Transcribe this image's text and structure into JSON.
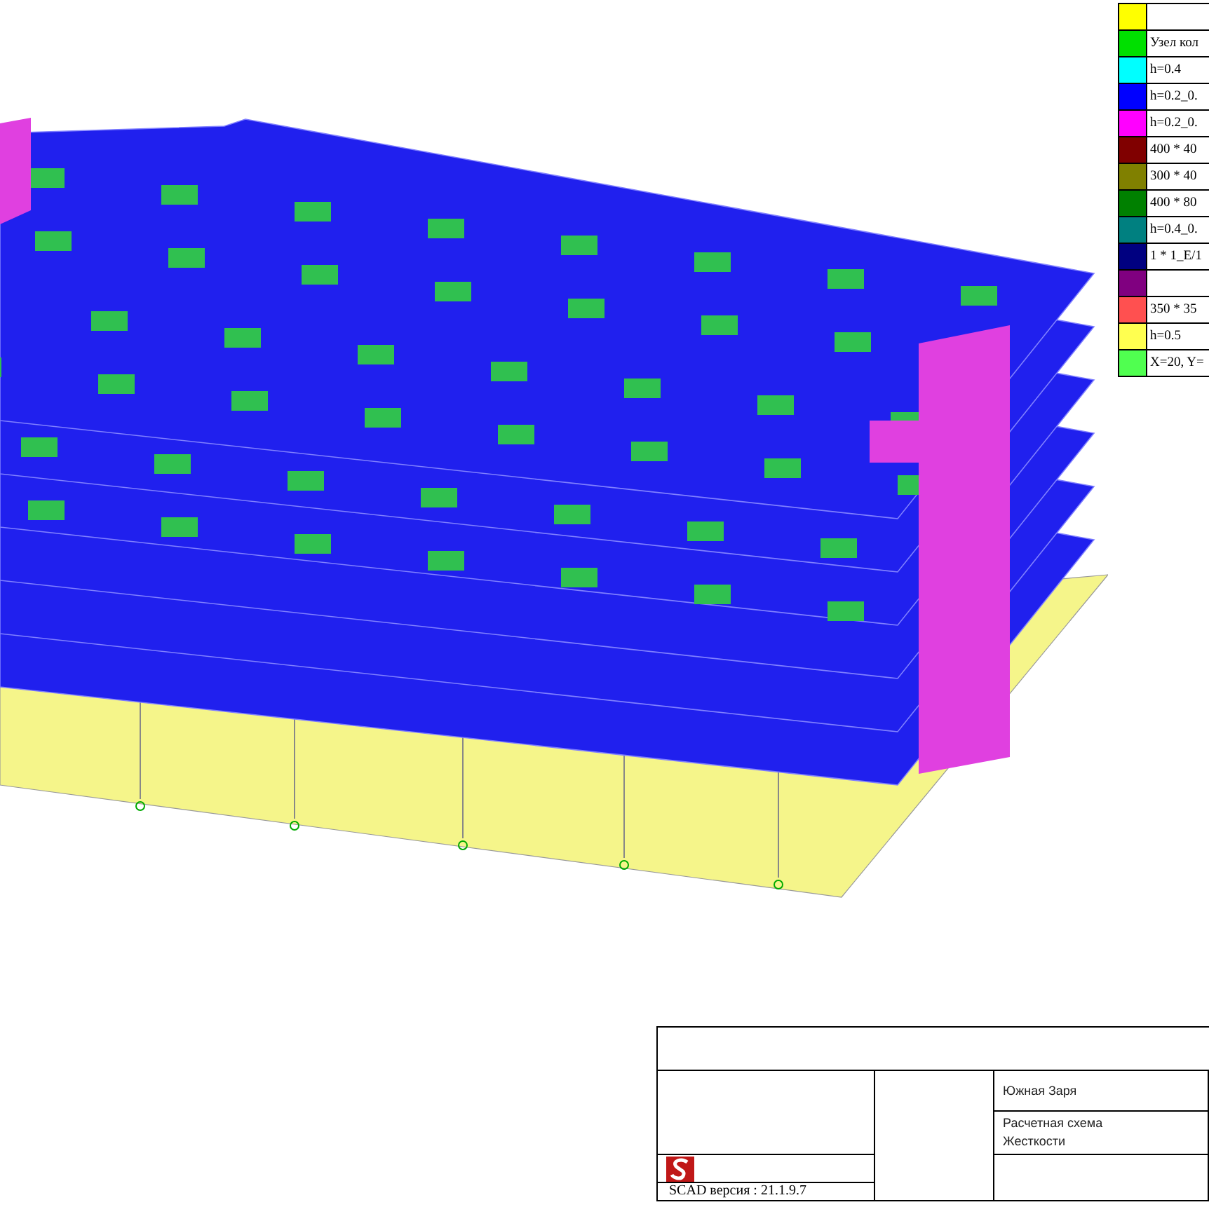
{
  "legend": [
    {
      "color": "#ffff00"
    },
    {
      "color": "#00e000",
      "label": "Узел кол"
    },
    {
      "color": "#00ffff",
      "label": "h=0.4"
    },
    {
      "color": "#0000ff",
      "label": "h=0.2_0."
    },
    {
      "color": "#ff00ff",
      "label": "h=0.2_0."
    },
    {
      "color": "#800000",
      "label": "400 * 40"
    },
    {
      "color": "#808000",
      "label": "300 * 40"
    },
    {
      "color": "#008000",
      "label": "400 * 80"
    },
    {
      "color": "#008080",
      "label": "h=0.4_0."
    },
    {
      "color": "#000080",
      "label": "1 * 1_E/1"
    },
    {
      "color": "#800080"
    },
    {
      "color": "#ff5050",
      "label": "350 * 35"
    },
    {
      "color": "#ffff50",
      "label": "h=0.5"
    },
    {
      "color": "#50ff50",
      "label": "X=20, Y="
    }
  ],
  "title_block": {
    "project": "Южная Заря",
    "sheet_title": [
      "Расчетная схема",
      "Жесткости"
    ],
    "version": "SCAD версия : 21.1.9.7"
  }
}
